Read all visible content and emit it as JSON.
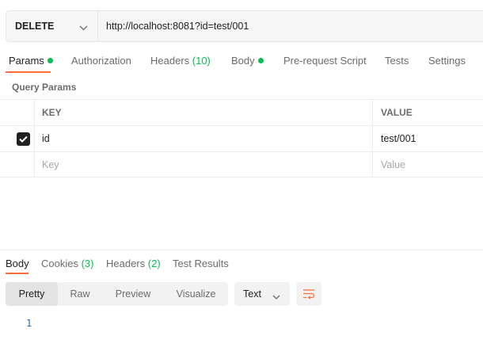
{
  "request": {
    "method": "DELETE",
    "url": "http://localhost:8081?id=test/001"
  },
  "request_tabs": [
    {
      "label": "Params",
      "dot": true
    },
    {
      "label": "Authorization"
    },
    {
      "label": "Headers",
      "count": "(10)"
    },
    {
      "label": "Body",
      "dot": true
    },
    {
      "label": "Pre-request Script"
    },
    {
      "label": "Tests"
    },
    {
      "label": "Settings"
    }
  ],
  "query_params": {
    "title": "Query Params",
    "headers": {
      "key": "KEY",
      "value": "VALUE"
    },
    "rows": [
      {
        "checked": true,
        "key": "id",
        "value": "test/001"
      }
    ],
    "placeholder": {
      "key": "Key",
      "value": "Value"
    }
  },
  "response_tabs": [
    {
      "label": "Body"
    },
    {
      "label": "Cookies",
      "count": "(3)"
    },
    {
      "label": "Headers",
      "count": "(2)"
    },
    {
      "label": "Test Results"
    }
  ],
  "view_modes": [
    "Pretty",
    "Raw",
    "Preview",
    "Visualize"
  ],
  "format": "Text",
  "line_number": "1",
  "colors": {
    "accent": "#ff6c37",
    "indicator": "#0cbb52"
  },
  "icons": {
    "dropdown": "chevron-down-icon",
    "check": "check-icon",
    "wrap": "wrap-lines-icon"
  }
}
